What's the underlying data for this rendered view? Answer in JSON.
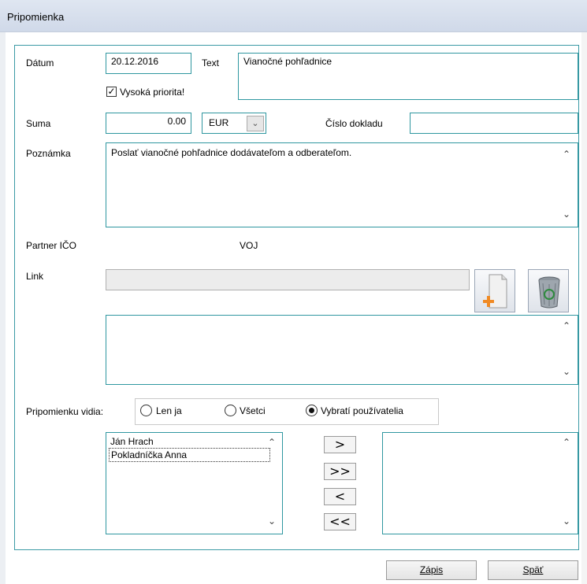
{
  "window": {
    "title": "Pripomienka"
  },
  "form": {
    "date_label": "Dátum",
    "date_value": "20.12.2016",
    "text_label": "Text",
    "text_value": "Vianočné pohľadnice",
    "priority_label": "Vysoká priorita!",
    "priority_checked": true,
    "amount_label": "Suma",
    "amount_value": "0.00",
    "currency_value": "EUR",
    "doc_number_label": "Číslo dokladu",
    "doc_number_value": "",
    "note_label": "Poznámka",
    "note_value": "Poslať vianočné pohľadnice dodávateľom a odberateľom.",
    "partner_label": "Partner IČO",
    "partner_value": "VOJ",
    "link_label": "Link",
    "link_value": "",
    "link_notes_value": ""
  },
  "visibility": {
    "label": "Pripomienku vidia:",
    "options": [
      {
        "label": "Len ja",
        "selected": false
      },
      {
        "label": "Všetci",
        "selected": false
      },
      {
        "label": "Vybratí používatelia",
        "selected": true
      }
    ]
  },
  "users": {
    "available": [
      "Ján Hrach",
      "Pokladníčka Anna"
    ],
    "selected": [],
    "move_buttons": [
      ">",
      ">>",
      "<",
      "<<"
    ]
  },
  "buttons": {
    "save_label": "Zápis",
    "back_label": "Späť"
  },
  "icons": {
    "add_link": "new-document-plus-icon",
    "delete_link": "recycle-bin-icon",
    "checkbox_mark": "✓",
    "scroll_up": "⌃",
    "scroll_down": "⌄",
    "dropdown": "⌄"
  },
  "colors": {
    "field_border": "#2f97a0",
    "panel_border": "#3b9aa5",
    "titlebar": "#d6deec"
  }
}
